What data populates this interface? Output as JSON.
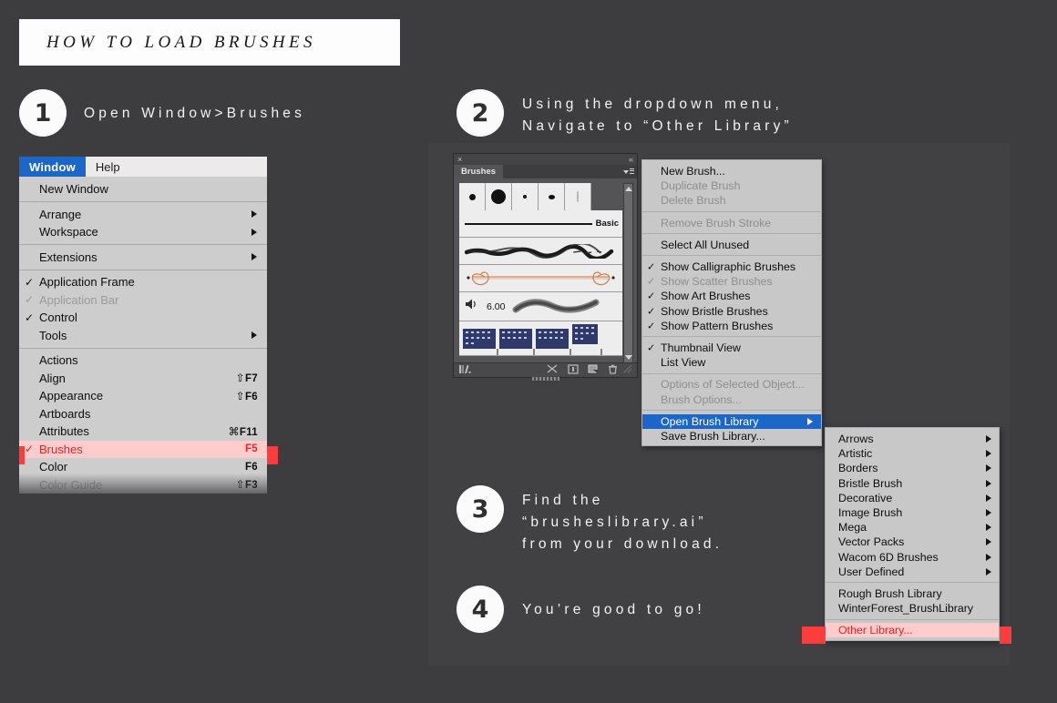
{
  "title": {
    "text": "HOW TO LOAD BRUSHES"
  },
  "steps": [
    {
      "num": "1",
      "text": "Open Window>Brushes"
    },
    {
      "num": "2",
      "text": "Using the dropdown menu,\nNavigate to “Other Library”"
    },
    {
      "num": "3",
      "text": "Find the\n“brusheslibrary.ai”\nfrom your download."
    },
    {
      "num": "4",
      "text": "You’re good to go!"
    }
  ],
  "window_menu": {
    "menubar": {
      "window": "Window",
      "help": "Help"
    },
    "items": [
      {
        "label": "New Window"
      },
      {
        "sep": true
      },
      {
        "label": "Arrange",
        "arrow": true
      },
      {
        "label": "Workspace",
        "arrow": true
      },
      {
        "sep": true
      },
      {
        "label": "Extensions",
        "arrow": true
      },
      {
        "sep": true
      },
      {
        "label": "Application Frame",
        "check": "✓"
      },
      {
        "label": "Application Bar",
        "check": "✓",
        "dim": true
      },
      {
        "label": "Control",
        "check": "✓"
      },
      {
        "label": "Tools",
        "arrow": true
      },
      {
        "sep": true
      },
      {
        "label": "Actions"
      },
      {
        "label": "Align",
        "shortcut_glyph": "⇧",
        "shortcut_key": "F7"
      },
      {
        "label": "Appearance",
        "shortcut_glyph": "⇧",
        "shortcut_key": "F6"
      },
      {
        "label": "Artboards"
      },
      {
        "label": "Attributes",
        "shortcut_glyph": "⌘",
        "shortcut_key": "F11"
      },
      {
        "label": "Brushes",
        "check": "✓",
        "shortcut_key": "F5",
        "selected": true
      },
      {
        "label": "Color",
        "shortcut_key": "F6"
      },
      {
        "label": "Color Guide",
        "shortcut_glyph": "⇧",
        "shortcut_key": "F3",
        "dim": true
      }
    ]
  },
  "brushes_panel": {
    "close_icon": "×",
    "collapse_icon": "«",
    "tab_label": "Brushes",
    "basic_label": "Basic",
    "bristle_size": "6.00",
    "footer_icons": [
      "library-icon",
      "scissors-icon",
      "options-icon",
      "new-brush-icon",
      "trash-icon"
    ],
    "colors": {
      "arrow_brush": "#d99a73"
    }
  },
  "context_menu": {
    "items": [
      {
        "label": "New Brush..."
      },
      {
        "label": "Duplicate Brush",
        "dim": true
      },
      {
        "label": "Delete Brush",
        "dim": true
      },
      {
        "sep": true
      },
      {
        "label": "Remove Brush Stroke",
        "dim": true
      },
      {
        "sep": true
      },
      {
        "label": "Select All Unused"
      },
      {
        "sep": true
      },
      {
        "label": "Show Calligraphic Brushes",
        "check": "✓"
      },
      {
        "label": "Show Scatter Brushes",
        "check": "✓",
        "dim": true
      },
      {
        "label": "Show Art Brushes",
        "check": "✓"
      },
      {
        "label": "Show Bristle Brushes",
        "check": "✓"
      },
      {
        "label": "Show Pattern Brushes",
        "check": "✓"
      },
      {
        "sep": true
      },
      {
        "label": "Thumbnail View",
        "check": "✓"
      },
      {
        "label": "List View"
      },
      {
        "sep": true
      },
      {
        "label": "Options of Selected Object...",
        "dim": true
      },
      {
        "label": "Brush Options...",
        "dim": true
      },
      {
        "sep": true
      },
      {
        "label": "Open Brush Library",
        "arrow": true,
        "highlighted": true
      },
      {
        "label": "Save Brush Library..."
      }
    ]
  },
  "sub_menu": {
    "items": [
      {
        "label": "Arrows",
        "arrow": true
      },
      {
        "label": "Artistic",
        "arrow": true
      },
      {
        "label": "Borders",
        "arrow": true
      },
      {
        "label": "Bristle Brush",
        "arrow": true
      },
      {
        "label": "Decorative",
        "arrow": true
      },
      {
        "label": "Image Brush",
        "arrow": true
      },
      {
        "label": "Mega",
        "arrow": true
      },
      {
        "label": "Vector Packs",
        "arrow": true
      },
      {
        "label": "Wacom 6D Brushes",
        "arrow": true
      },
      {
        "label": "User Defined",
        "arrow": true
      },
      {
        "sep": true
      },
      {
        "label": "Rough Brush Library"
      },
      {
        "label": "WinterForest_BrushLibrary"
      },
      {
        "sep": true
      },
      {
        "label": "Other Library...",
        "selected": true
      }
    ]
  },
  "colors": {
    "background": "#3d3d40",
    "accent_blue": "#1a66c9",
    "highlight_red": "#fd3d3d",
    "selected_text_red": "#e8232a",
    "menu_gray": "#c8c8c8"
  }
}
